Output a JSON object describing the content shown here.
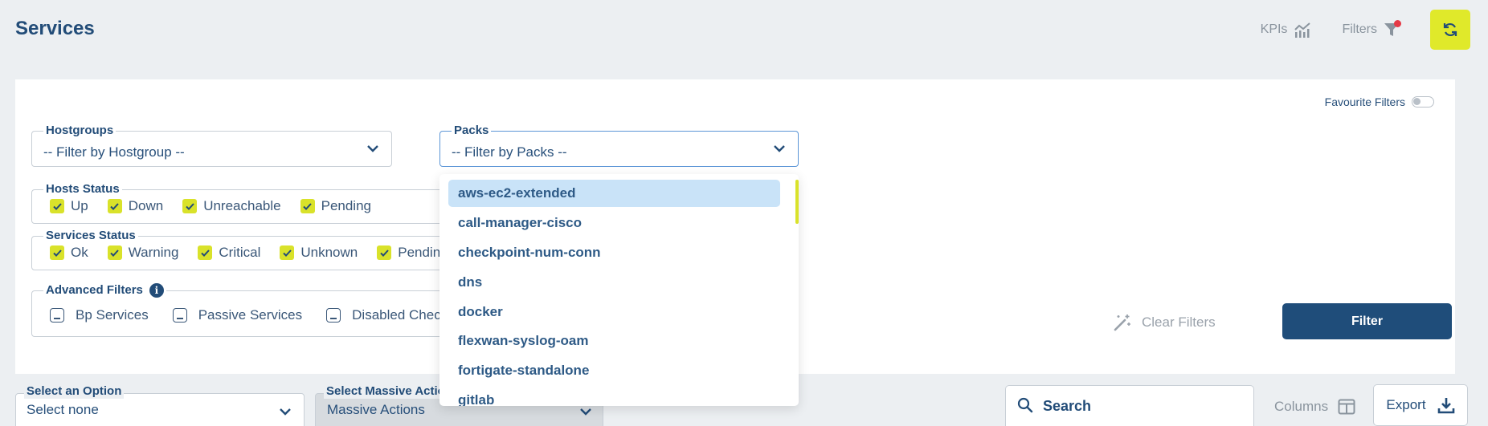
{
  "header": {
    "title": "Services",
    "kpis_label": "KPIs",
    "filters_label": "Filters"
  },
  "favourite_filters": "Favourite Filters",
  "hostgroups": {
    "label": "Hostgroups",
    "value": "-- Filter by Hostgroup --"
  },
  "packs": {
    "label": "Packs",
    "value": "-- Filter by Packs --"
  },
  "hosts_status": {
    "label": "Hosts Status",
    "items": [
      "Up",
      "Down",
      "Unreachable",
      "Pending"
    ]
  },
  "services_status": {
    "label": "Services Status",
    "items": [
      "Ok",
      "Warning",
      "Critical",
      "Unknown",
      "Pending"
    ]
  },
  "advanced_filters": {
    "label": "Advanced Filters",
    "items": [
      "Bp Services",
      "Passive Services",
      "Disabled Checks"
    ]
  },
  "clear_filters": "Clear Filters",
  "filter_button": "Filter",
  "packs_dropdown": {
    "items": [
      "aws-ec2-extended",
      "call-manager-cisco",
      "checkpoint-num-conn",
      "dns",
      "docker",
      "flexwan-syslog-oam",
      "fortigate-standalone",
      "gitlab"
    ]
  },
  "select_option": {
    "label": "Select an Option",
    "value": "Select none"
  },
  "massive_actions": {
    "label": "Select Massive Actions",
    "value": "Massive Actions"
  },
  "search": {
    "label": "Search"
  },
  "columns_label": "Columns",
  "export_label": "Export",
  "colors": {
    "accent": "#e0e92a",
    "primary": "#1f4d7a",
    "alert": "#e53946"
  }
}
